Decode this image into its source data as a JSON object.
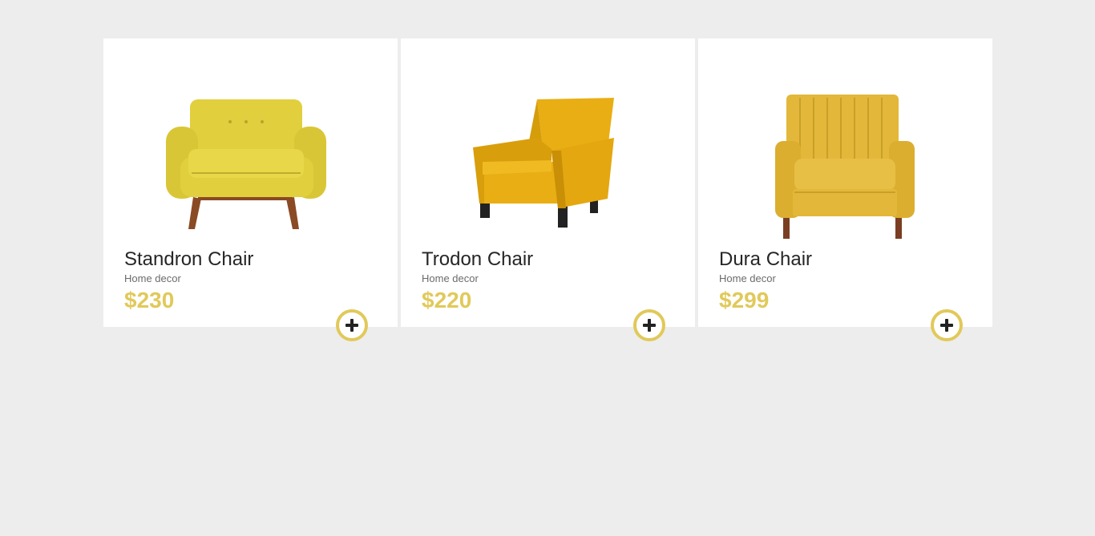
{
  "products": [
    {
      "name": "Standron Chair",
      "category": "Home decor",
      "price": "$230",
      "icon": "armchair-mustard-icon",
      "colors": {
        "body": "#e1cf3e",
        "shade": "#c7b42e",
        "legs": "#8a4a24"
      }
    },
    {
      "name": "Trodon Chair",
      "category": "Home decor",
      "price": "$220",
      "icon": "armchair-velvet-icon",
      "colors": {
        "body": "#e9ae13",
        "shade": "#cf9708",
        "legs": "#222222"
      }
    },
    {
      "name": "Dura Chair",
      "category": "Home decor",
      "price": "$299",
      "icon": "armchair-channel-icon",
      "colors": {
        "body": "#e3b739",
        "shade": "#c99f28",
        "legs": "#7a3e22"
      }
    }
  ],
  "theme": {
    "accent": "#e1c95a",
    "background": "#ededed",
    "card": "#ffffff",
    "text": "#262626",
    "muted": "#6b6b6b"
  }
}
